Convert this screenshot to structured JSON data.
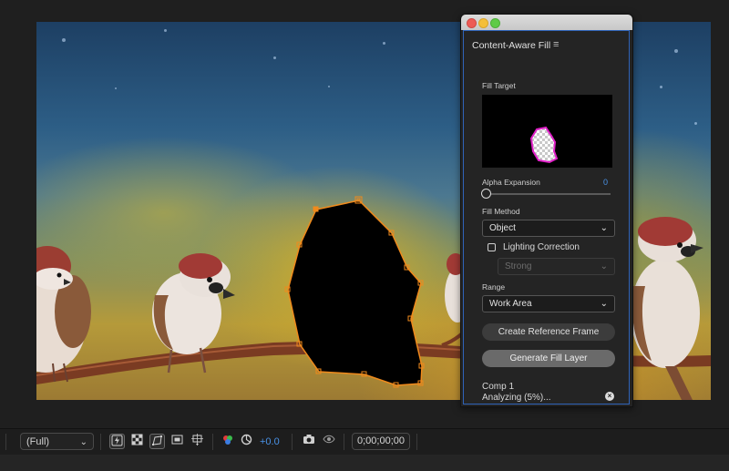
{
  "panel": {
    "title": "Content-Aware Fill",
    "menu_icon": "hamburger-menu-icon",
    "fill_target_label": "Fill Target",
    "alpha_expansion": {
      "label": "Alpha Expansion",
      "value": "0"
    },
    "fill_method": {
      "label": "Fill Method",
      "selected": "Object"
    },
    "lighting_correction": {
      "label": "Lighting Correction",
      "checked": false
    },
    "lighting_strength": {
      "selected": "Strong",
      "disabled": true
    },
    "range": {
      "label": "Range",
      "selected": "Work Area"
    },
    "create_reference_label": "Create Reference Frame",
    "generate_fill_label": "Generate Fill Layer",
    "status": {
      "comp": "Comp 1",
      "progress_text": "Analyzing (5%)...",
      "progress": 0.05
    }
  },
  "toolbar": {
    "resolution": "(Full)",
    "exposure": "+0.0",
    "timecode": "0;00;00;00",
    "icons": [
      "fast-previews-icon",
      "transparency-grid-icon",
      "mask-visibility-icon",
      "region-of-interest-icon",
      "guides-icon",
      "color-channels-icon",
      "reset-exposure-icon",
      "snapshot-icon",
      "show-snapshot-icon"
    ]
  },
  "colors": {
    "accent": "#2f7de1",
    "mask_outline": "#f08a1c",
    "panel_bg": "#242424",
    "viewer_bg": "#1f1f1f"
  }
}
